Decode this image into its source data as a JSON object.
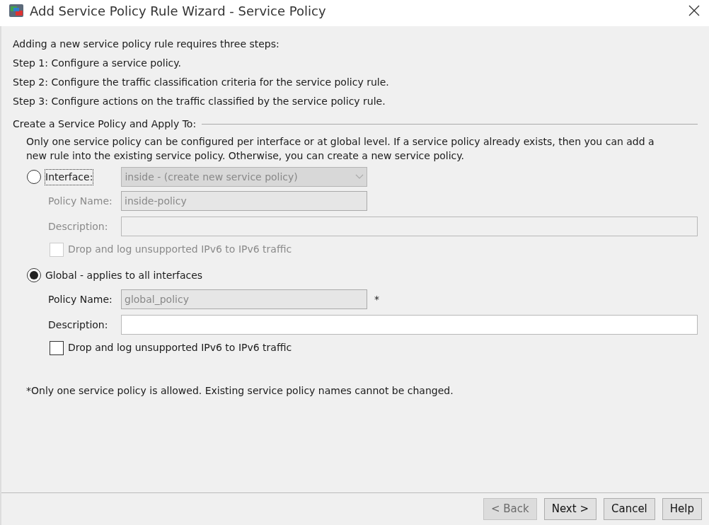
{
  "window": {
    "title": "Add Service Policy Rule Wizard - Service Policy"
  },
  "intro": [
    "Adding a new service policy rule requires three steps:",
    "Step 1:  Configure a service policy.",
    "Step 2:  Configure the traffic classification criteria for the service policy rule.",
    "Step 3:  Configure actions on the traffic classified by the service policy rule."
  ],
  "group": {
    "legend": "Create a Service Policy and Apply To:",
    "note": "Only one service policy can be configured per interface or at global level. If a service policy already exists, then you can add a new rule into the existing service policy. Otherwise, you can create a new service policy.",
    "options": [
      {
        "kind": "interface",
        "label": "Interface:",
        "selected": false,
        "dropdown": {
          "value": "inside - (create new service policy)"
        },
        "policy_name": {
          "label": "Policy Name:",
          "value": "inside-policy",
          "readonly": true
        },
        "description": {
          "label": "Description:"
        },
        "drop_ipv6": {
          "label": "Drop and log unsupported IPv6 to IPv6 traffic",
          "checked": false
        }
      },
      {
        "kind": "global",
        "label": "Global - applies to all interfaces",
        "selected": true,
        "policy_name": {
          "label": "Policy Name:",
          "value": "global_policy",
          "readonly": true,
          "required_mark": "*"
        },
        "description": {
          "label": "Description:"
        },
        "drop_ipv6": {
          "label": "Drop and log unsupported IPv6 to IPv6 traffic",
          "checked": false
        }
      }
    ]
  },
  "footnote": "*Only one service policy is allowed. Existing service policy names cannot be changed.",
  "buttons": [
    {
      "label": "< Back",
      "disabled": true
    },
    {
      "label": "Next >",
      "disabled": false
    },
    {
      "label": "Cancel",
      "disabled": false
    },
    {
      "label": "Help",
      "disabled": false
    }
  ]
}
